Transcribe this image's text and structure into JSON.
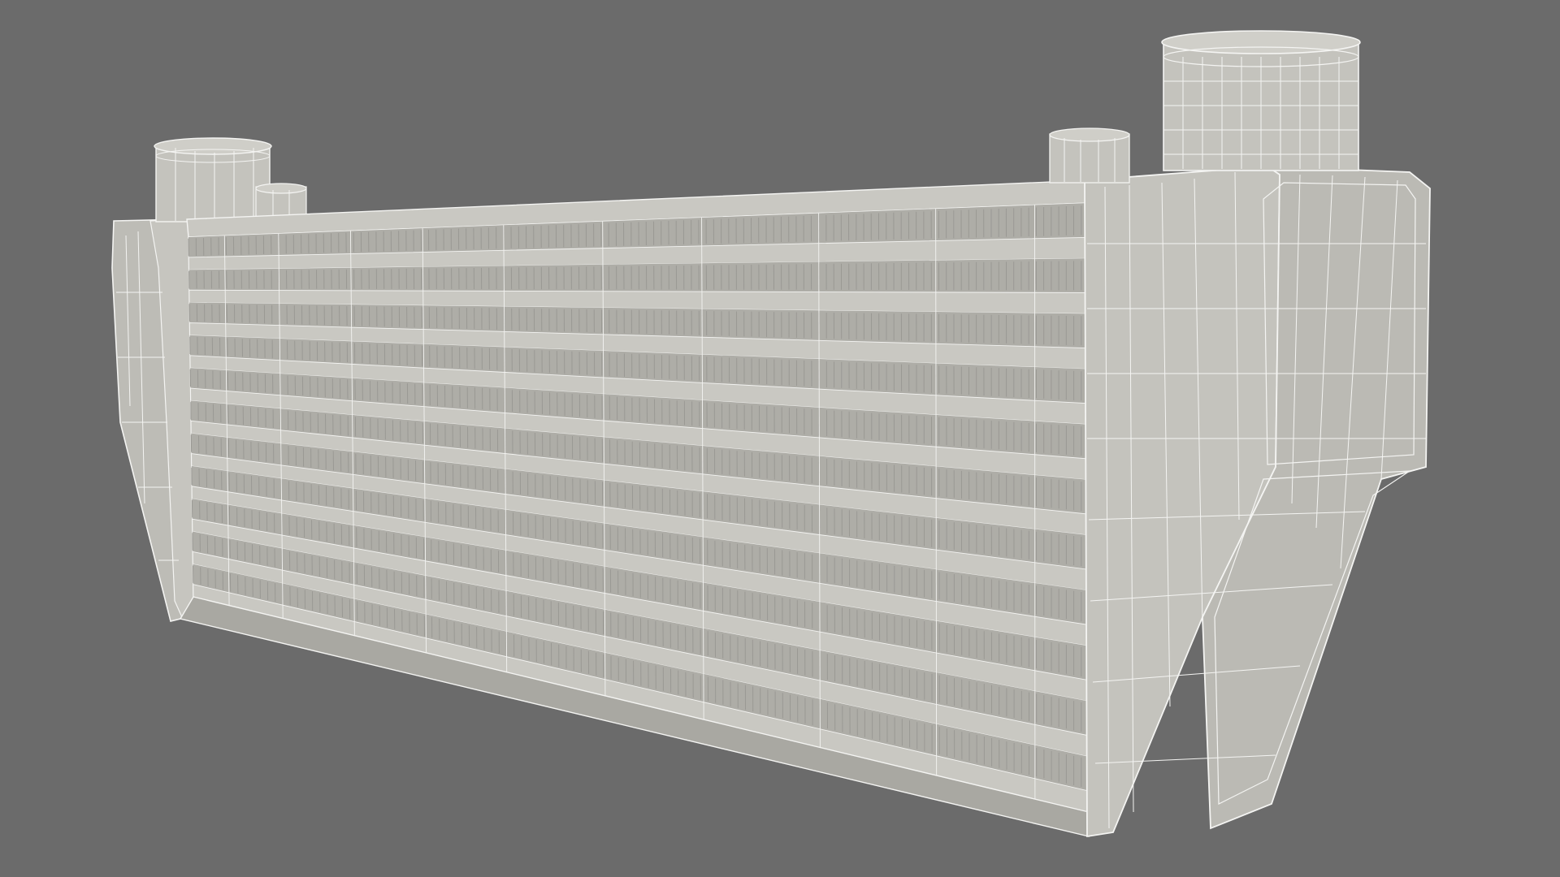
{
  "scene": {
    "subject": "intercooler-wireframe-render",
    "colors": {
      "background": "#6b6b6b",
      "body_fill": "#bdbcb6",
      "body_fill_light": "#c9c8c2",
      "body_fill_dark": "#a9a8a2",
      "fin_fill": "#b3b2ac",
      "fin_stroke": "#9a9994",
      "wire": "#f4f4f2",
      "shadow": "#8f8e89"
    },
    "core": {
      "tube_rows": 11
    },
    "icons": {
      "left_top_cap": "outlet-pipe-icon",
      "left_small_cap": "bleed-port-icon",
      "right_small_cap": "bleed-port-icon",
      "right_big_cap": "inlet-pipe-icon"
    }
  }
}
